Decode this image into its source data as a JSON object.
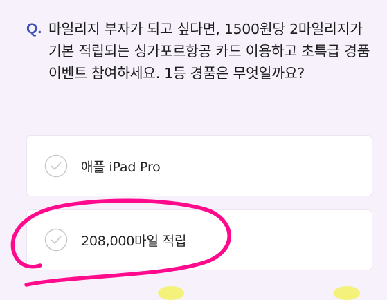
{
  "question": {
    "prefix": "Q.",
    "text": "마일리지 부자가 되고 싶다면, 1500원당 2마일리지가 기본 적립되는 싱가포르항공 카드 이용하고 초특급 경품 이벤트 참여하세요. 1등 경품은 무엇일까요?"
  },
  "options": [
    {
      "label": "애플 iPad Pro",
      "icon": "check-circle-icon"
    },
    {
      "label": "208,000마일 적립",
      "icon": "check-circle-icon"
    }
  ],
  "colors": {
    "background": "#f6f1fb",
    "accent": "#3f51b5",
    "annotation": "#ff0a8c",
    "check": "#c8c8cc"
  }
}
